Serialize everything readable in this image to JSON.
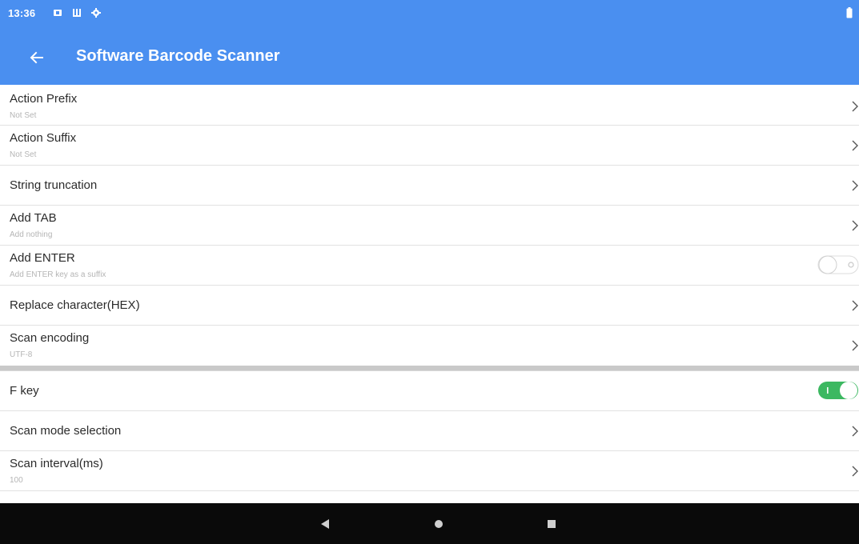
{
  "status_bar": {
    "time": "13:36",
    "icons": [
      "notification-square-icon",
      "storage-icon",
      "settings-gear-icon"
    ],
    "battery_icon": "battery-icon"
  },
  "app_bar": {
    "back_icon": "arrow-left-icon",
    "title": "Software Barcode Scanner",
    "color": "#4a8ff0"
  },
  "settings": [
    {
      "title": "Action Prefix",
      "subtitle": "Not Set",
      "control": "chevron"
    },
    {
      "title": "Action Suffix",
      "subtitle": "Not Set",
      "control": "chevron"
    },
    {
      "title": "String truncation",
      "subtitle": "",
      "control": "chevron"
    },
    {
      "title": "Add TAB",
      "subtitle": "Add nothing",
      "control": "chevron"
    },
    {
      "title": "Add ENTER",
      "subtitle": "Add ENTER key as a suffix",
      "control": "toggle",
      "toggle_on": false
    },
    {
      "title": "Replace character(HEX)",
      "subtitle": "",
      "control": "chevron"
    },
    {
      "title": "Scan encoding",
      "subtitle": "UTF-8",
      "control": "chevron"
    },
    {
      "title": "F key",
      "subtitle": "",
      "control": "toggle",
      "toggle_on": true
    },
    {
      "title": "Scan mode selection",
      "subtitle": "",
      "control": "chevron"
    },
    {
      "title": "Scan interval(ms)",
      "subtitle": "100",
      "control": "chevron"
    }
  ],
  "colors": {
    "accent": "#4a8ff0",
    "toggle_on": "#3cb861",
    "toggle_off_track": "#ffffff",
    "subtitle": "#b5b5b5"
  },
  "nav_bar": {
    "back_icon": "nav-back-triangle-icon",
    "home_icon": "nav-home-circle-icon",
    "recents_icon": "nav-recents-square-icon"
  }
}
